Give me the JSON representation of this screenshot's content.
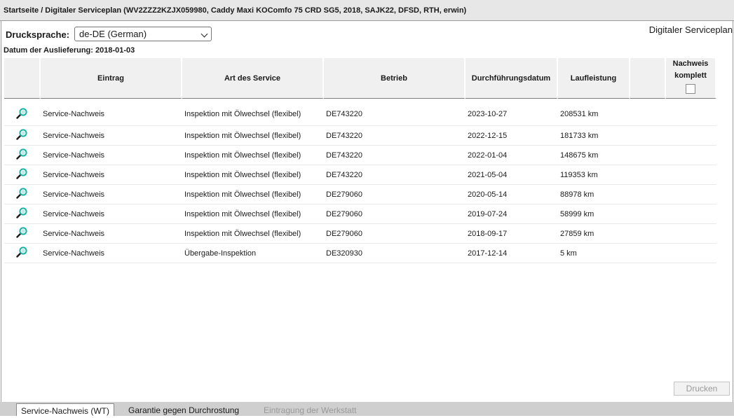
{
  "header": {
    "breadcrumb": "Startseite / Digitaler Serviceplan (WV2ZZZ2KZJX059980, Caddy Maxi KOComfo 75 CRD SG5, 2018, SAJK22, DFSD, RTH, erwin)"
  },
  "toolbar": {
    "print_language_label": "Drucksprache:",
    "print_language_value": "de-DE (German)",
    "section_title": "Digitaler Serviceplan"
  },
  "delivery_date": "Datum der Auslieferung: 2018-01-03",
  "table": {
    "columns": [
      "",
      "Eintrag",
      "Art des Service",
      "Betrieb",
      "Durchführungsdatum",
      "Laufleistung",
      "",
      "Nachweis komplett"
    ],
    "rows": [
      {
        "entry": "Service-Nachweis",
        "service": "Inspektion mit Ölwechsel (flexibel)",
        "shop": "DE743220",
        "date": "2023-10-27",
        "mileage": "208531 km"
      },
      {
        "entry": "Service-Nachweis",
        "service": "Inspektion mit Ölwechsel (flexibel)",
        "shop": "DE743220",
        "date": "2022-12-15",
        "mileage": "181733 km"
      },
      {
        "entry": "Service-Nachweis",
        "service": "Inspektion mit Ölwechsel (flexibel)",
        "shop": "DE743220",
        "date": "2022-01-04",
        "mileage": "148675 km"
      },
      {
        "entry": "Service-Nachweis",
        "service": "Inspektion mit Ölwechsel (flexibel)",
        "shop": "DE743220",
        "date": "2021-05-04",
        "mileage": "119353 km"
      },
      {
        "entry": "Service-Nachweis",
        "service": "Inspektion mit Ölwechsel (flexibel)",
        "shop": "DE279060",
        "date": "2020-05-14",
        "mileage": "88978 km"
      },
      {
        "entry": "Service-Nachweis",
        "service": "Inspektion mit Ölwechsel (flexibel)",
        "shop": "DE279060",
        "date": "2019-07-24",
        "mileage": "58999 km"
      },
      {
        "entry": "Service-Nachweis",
        "service": "Inspektion mit Ölwechsel (flexibel)",
        "shop": "DE279060",
        "date": "2018-09-17",
        "mileage": "27859 km"
      },
      {
        "entry": "Service-Nachweis",
        "service": "Übergabe-Inspektion",
        "shop": "DE320930",
        "date": "2017-12-14",
        "mileage": "5 km"
      }
    ]
  },
  "actions": {
    "print_label": "Drucken"
  },
  "tabs": [
    {
      "label": "Service-Nachweis (WT)",
      "state": "active"
    },
    {
      "label": "Garantie gegen Durchrostung",
      "state": "normal"
    },
    {
      "label": "Eintragung der Werkstatt",
      "state": "disabled"
    }
  ],
  "icons": {
    "row_icon": "magnifier-icon",
    "select_arrow": "chevron-down-icon"
  },
  "colors": {
    "magnifier_lens": "#1fb1a5",
    "header_bg": "#f0f0f0",
    "tabbar_bg": "#cfcfcf"
  }
}
